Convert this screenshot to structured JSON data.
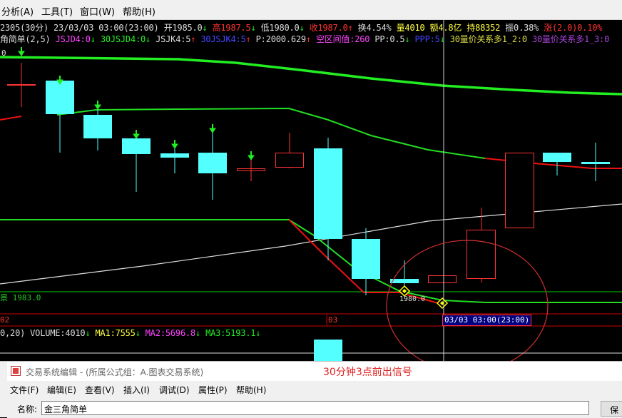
{
  "menubar": {
    "items": [
      "分析(A)",
      "工具(T)",
      "窗口(W)",
      "帮助(H)"
    ]
  },
  "quote_line": {
    "period": "2305(30分)",
    "datetime": "23/03/03 03:00(23:00)",
    "open": "开1985.0",
    "open_arrow": "↓",
    "high": "高1987.5",
    "high_arrow": "↓",
    "low": "低1980.0",
    "low_arrow": "↓",
    "close": "收1987.0",
    "close_arrow": "↑",
    "turnover_rate": "换4.54%",
    "volume": "量4010",
    "amount": "额4.8亿",
    "open_interest": "持88352",
    "amplitude": "振0.38%",
    "change": "涨(2.0)0.10%"
  },
  "indicator_line": {
    "name": "角简单(2,5)",
    "jsjd4": "JSJD4:0",
    "jsjd4_arrow": "↓",
    "jsjd30": "30JSJD4:0",
    "jsjd30_arrow": "↓",
    "jsjk4": "JSJK4:5",
    "jsjk4_arrow": "↑",
    "jsjk30": "30JSJK4:5",
    "jsjk30_arrow": "↑",
    "p": "P:2000.629",
    "p_arrow": "↑",
    "gap": "空区间值:260",
    "pp": "PP:0.5",
    "pp_arrow": "↓",
    "ppp": "PPP:5",
    "ppp_arrow": "↓",
    "rel1": "30量价关系多1_2:0",
    "rel2": "30量价关系多1_3:0"
  },
  "price_labels": {
    "top_left": "0",
    "horizontal_line_label": "景 1983.0",
    "signal_label": "1980.0"
  },
  "time_axis": {
    "left_label": "02",
    "mid_label": "03",
    "crosshair_time": "03/03 03:00(23:00)"
  },
  "volume_line": {
    "params": "0,20)",
    "volume": "VOLUME:4010",
    "volume_arrow": "↓",
    "ma1": "MA1:7555",
    "ma1_arrow": "↓",
    "ma2": "MA2:5696.8",
    "ma2_arrow": "↓",
    "ma3": "MA3:5193.1",
    "ma3_arrow": "↓"
  },
  "annotation": "30分钟3点前出信号",
  "editor": {
    "title": "交易系统编辑 - (所属公式组：A.图表交易系统)",
    "menu": [
      "文件(F)",
      "编辑(E)",
      "查看(V)",
      "插入(I)",
      "调试(D)",
      "属性(P)",
      "帮助(H)"
    ],
    "name_label": "名称:",
    "name_value": "金三角简单",
    "save_button": "保"
  },
  "colors": {
    "up": "#ff3333",
    "down": "#54ffff",
    "ma_green": "#00dd00",
    "line_red": "#ff2020",
    "white_line": "#e0e0e0",
    "annotation_red": "#e02020",
    "crosshair_label_bg": "#000080"
  }
}
